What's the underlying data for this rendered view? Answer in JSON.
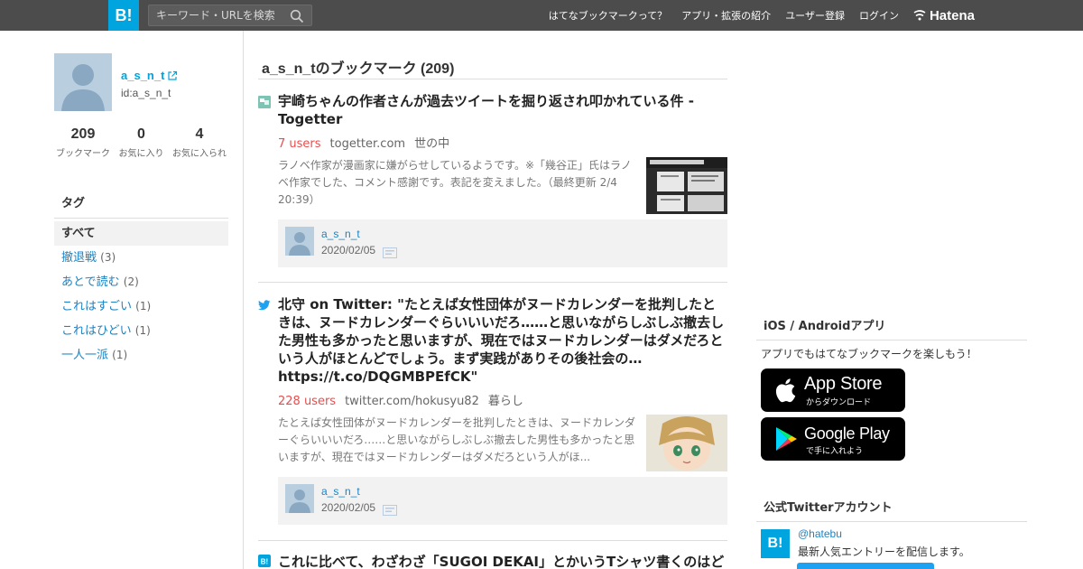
{
  "header": {
    "logo_text": "B!",
    "search_placeholder": "キーワード・URLを検索",
    "nav": [
      "はてなブックマークって？",
      "アプリ・拡張の紹介",
      "ユーザー登録",
      "ログイン"
    ],
    "brand": "Hatena"
  },
  "profile": {
    "username": "a_s_n_t",
    "user_id": "id:a_s_n_t",
    "stats": [
      {
        "value": "209",
        "label": "ブックマーク"
      },
      {
        "value": "0",
        "label": "お気に入り"
      },
      {
        "value": "4",
        "label": "お気に入られ"
      }
    ]
  },
  "tags": {
    "heading": "タグ",
    "all_label": "すべて",
    "items": [
      {
        "name": "撤退戦",
        "count": "(3)"
      },
      {
        "name": "あとで読む",
        "count": "(2)"
      },
      {
        "name": "これはすごい",
        "count": "(1)"
      },
      {
        "name": "これはひどい",
        "count": "(1)"
      },
      {
        "name": "一人一派",
        "count": "(1)"
      }
    ]
  },
  "main": {
    "title": "a_s_n_tのブックマーク (209)",
    "entries": [
      {
        "title": "宇崎ちゃんの作者さんが過去ツイートを掘り返され叩かれている件 - Togetter",
        "users": "7 users",
        "domain": "togetter.com",
        "category": "世の中",
        "description": "ラノベ作家が漫画家に嫌がらせしているようです。※「幾谷正」氏はラノベ作家でした、コメント感謝です。表記を変えました。（最終更新 2/4 20:39）",
        "bookmark_user": "a_s_n_t",
        "bookmark_date": "2020/02/05",
        "site_icon": "togetter-icon"
      },
      {
        "title": "北守 on Twitter: \"たとえば女性団体がヌードカレンダーを批判したときは、ヌードカレンダーぐらいいいだろ……と思いながらしぶしぶ撤去した男性も多かったと思いますが、現在ではヌードカレンダーはダメだろという人がほとんどでしょう。まず実践がありその後社会の… https://t.co/DQGMBPEfCK\"",
        "users": "228 users",
        "domain": "twitter.com/hokusyu82",
        "category": "暮らし",
        "description": "たとえば女性団体がヌードカレンダーを批判したときは、ヌードカレンダーぐらいいいだろ……と思いながらしぶしぶ撤去した男性も多かったと思いますが、現在ではヌードカレンダーはダメだろという人がほ...",
        "bookmark_user": "a_s_n_t",
        "bookmark_date": "2020/02/05",
        "site_icon": "twitter-icon"
      },
      {
        "title": "これに比べて、わざわざ「SUGOI DEKAI」とかいうTシャツ書くのはど",
        "site_icon": "hatena-icon"
      }
    ]
  },
  "sidebar_right": {
    "apps_heading": "iOS / Androidアプリ",
    "apps_text": "アプリでもはてなブックマークを楽しもう！",
    "app_store_big": "App Store",
    "app_store_small": "からダウンロード",
    "google_play_big": "Google Play",
    "google_play_small": "で手に入れよう",
    "twitter_heading": "公式Twitterアカウント",
    "twitter_logo": "B!",
    "twitter_handle": "@hatebu",
    "twitter_desc": "最新人気エントリーを配信します。"
  },
  "colors": {
    "topbar": "#4c4c4c",
    "brand_blue": "#00a4de",
    "link_blue": "#1b83c4",
    "users_red": "#e84e4e"
  }
}
